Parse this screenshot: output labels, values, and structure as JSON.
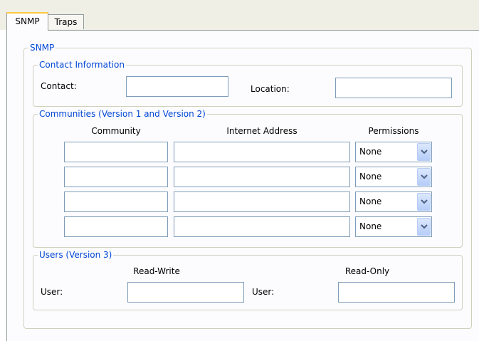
{
  "tabs": [
    {
      "label": "SNMP",
      "active": true
    },
    {
      "label": "Traps",
      "active": false
    }
  ],
  "snmp_group": {
    "legend": "SNMP"
  },
  "contact_group": {
    "legend": "Contact Information",
    "contact_label": "Contact:",
    "contact_value": "",
    "location_label": "Location:",
    "location_value": ""
  },
  "communities_group": {
    "legend": "Communities (Version 1 and Version 2)",
    "headers": {
      "community": "Community",
      "address": "Internet Address",
      "permissions": "Permissions"
    },
    "rows": [
      {
        "community": "",
        "address": "",
        "permission": "None"
      },
      {
        "community": "",
        "address": "",
        "permission": "None"
      },
      {
        "community": "",
        "address": "",
        "permission": "None"
      },
      {
        "community": "",
        "address": "",
        "permission": "None"
      }
    ]
  },
  "users_group": {
    "legend": "Users (Version 3)",
    "rw_header": "Read-Write",
    "ro_header": "Read-Only",
    "rw_user_label": "User:",
    "ro_user_label": "User:",
    "rw_user_value": "",
    "ro_user_value": ""
  },
  "colors": {
    "legend": "#0046d5",
    "active_tab_accent": "#ffc83c",
    "input_border": "#7f9db9"
  },
  "icons": {
    "combo_arrow": "chevron-down-icon"
  }
}
